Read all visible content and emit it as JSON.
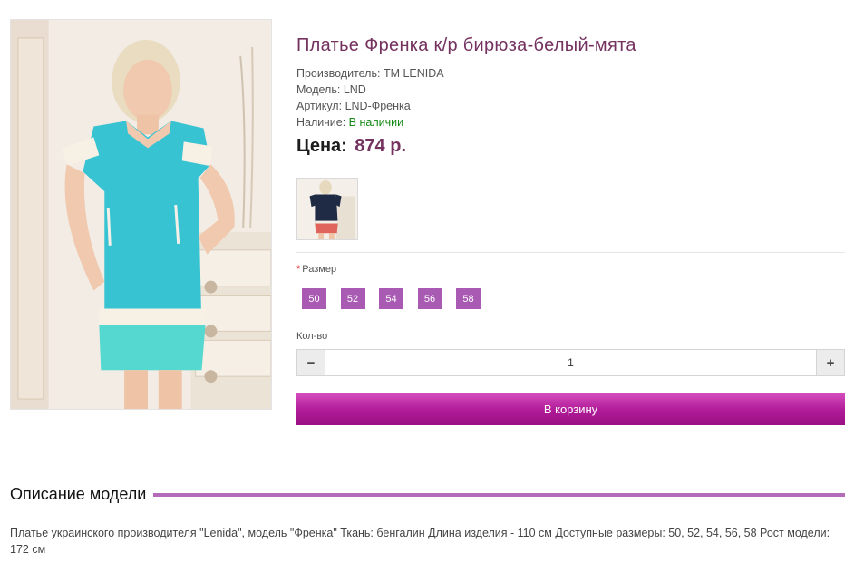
{
  "product": {
    "title": "Платье Френка к/р бирюза-белый-мята",
    "manufacturer_label": "Производитель:",
    "manufacturer": "ТМ LENIDA",
    "model_label": "Модель:",
    "model": "LND",
    "sku_label": "Артикул:",
    "sku": "LND-Френка",
    "availability_label": "Наличие:",
    "availability": "В наличии",
    "price_label": "Цена:",
    "price": "874 р."
  },
  "options": {
    "size_required_mark": "*",
    "size_label": "Размер",
    "sizes": [
      "50",
      "52",
      "54",
      "56",
      "58"
    ],
    "quantity_label": "Кол-во",
    "quantity_value": "1",
    "minus_symbol": "−",
    "plus_symbol": "+"
  },
  "cart_button_label": "В корзину",
  "description": {
    "heading": "Описание модели",
    "text": "Платье украинского производителя \"Lenida\", модель \"Френка\" Ткань: бенгалин Длина изделия - 110 см Доступные размеры: 50, 52, 54, 56, 58 Рост модели: 172 см"
  },
  "colors": {
    "title": "#74325f",
    "size_button": "#a95bb4",
    "cart_button": "#b01a98",
    "accent_line": "#b46cba",
    "in_stock": "#158a15"
  }
}
